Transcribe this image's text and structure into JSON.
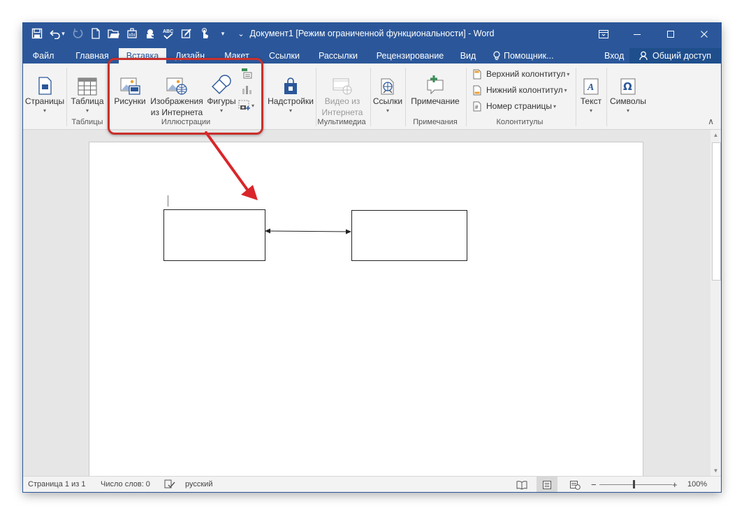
{
  "window": {
    "title": "Документ1 [Режим ограниченной функциональности] - Word",
    "controls": {
      "ribbon_options": "ribbon-display-options",
      "minimize": "minimize",
      "maximize": "maximize",
      "close": "close"
    }
  },
  "quick_access": {
    "icons": [
      "save-icon",
      "undo-icon",
      "redo-icon",
      "new-document-icon",
      "open-icon",
      "touch-mode-icon",
      "check-icon",
      "spelling-icon",
      "edit-icon",
      "touch-icon",
      "customize-icon"
    ],
    "undo_dropdown": "▾",
    "customize_glyph": "⌄"
  },
  "tabs": {
    "items": [
      "Файл",
      "Главная",
      "Вставка",
      "Дизайн",
      "Макет",
      "Ссылки",
      "Рассылки",
      "Рецензирование",
      "Вид"
    ],
    "active": "Вставка",
    "assistant": "Помощник...",
    "signin": "Вход",
    "share": "Общий доступ"
  },
  "ribbon": {
    "pages": "Страницы",
    "table": "Таблица",
    "tables_group": "Таблицы",
    "pictures": "Рисунки",
    "online_pictures_1": "Изображения",
    "online_pictures_2": "из Интернета",
    "shapes": "Фигуры",
    "illustrations_group": "Иллюстрации",
    "addins": "Надстройки",
    "online_video_1": "Видео из",
    "online_video_2": "Интернета",
    "media_group": "Мультимедиа",
    "links": "Ссылки",
    "comment": "Примечание",
    "comments_group": "Примечания",
    "header": "Верхний колонтитул",
    "footer": "Нижний колонтитул",
    "page_number": "Номер страницы",
    "header_footer_group": "Колонтитулы",
    "text": "Текст",
    "symbols": "Символы",
    "dropdown_glyph": "▾",
    "collapse_glyph": "∧"
  },
  "status": {
    "page": "Страница 1 из 1",
    "words": "Число слов: 0",
    "language": "русский",
    "zoom_minus": "−",
    "zoom_plus": "+",
    "zoom": "100%",
    "zoom_level": 1.0
  },
  "colors": {
    "accent": "#2b579a",
    "highlight": "#c9302c"
  }
}
